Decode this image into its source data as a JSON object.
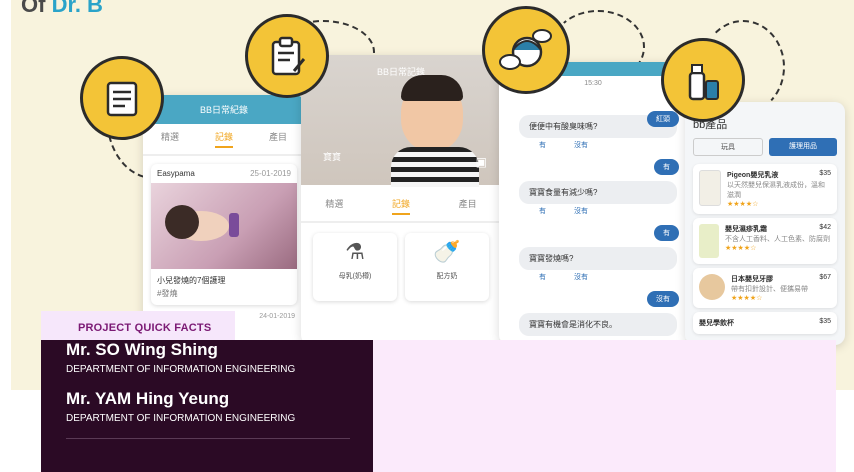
{
  "hero": {
    "title_prefix": "Of",
    "title_highlight": "Dr. B"
  },
  "phone1": {
    "header": "BB日常紀錄",
    "tabs": [
      "精選",
      "記錄",
      "產目"
    ],
    "post_author": "Easypama",
    "post_date": "25-01-2019",
    "post_caption": "小兒發燒的7個護理",
    "post_tag": "#發燒",
    "post2_date": "24-01-2019"
  },
  "phone2": {
    "header": "BB日常記錄",
    "baby_name": "寶寶",
    "tabs": [
      "精選",
      "記錄",
      "產目"
    ],
    "grid": [
      "母乳(奶樽)",
      "配方奶"
    ]
  },
  "phone3": {
    "time": "15:30",
    "top_btn": "紅頭",
    "questions": [
      "便便中有酸臭味嗎?",
      "寶寶食量有減少嗎?",
      "寶寶發燒嗎?",
      "寶寶有機會是消化不良。"
    ],
    "yes": "有",
    "no": "沒有",
    "answers": [
      "有",
      "有",
      "沒有"
    ]
  },
  "phone4": {
    "title": "bb產品",
    "tab_left": "玩具",
    "tab_right": "護理用品",
    "products": [
      {
        "name": "Pigeon嬰兒乳液",
        "price": "$35",
        "desc": "以天然嬰兒保濕乳液成份，溫和滋潤",
        "stars": "★★★★☆"
      },
      {
        "name": "嬰兒濕疹乳霜",
        "price": "$42",
        "desc": "不含人工香料、人工色素、防腐劑",
        "stars": "★★★★☆"
      },
      {
        "name": "日本嬰兒牙膠",
        "price": "$67",
        "desc": "帶有扣針設計、便攜易帶",
        "stars": "★★★★☆"
      },
      {
        "name": "嬰兒學飲杯",
        "price": "$35",
        "desc": "",
        "stars": ""
      }
    ]
  },
  "facts": {
    "label": "PROJECT QUICK FACTS",
    "people": [
      {
        "name": "Mr. SO Wing Shing",
        "dept": "DEPARTMENT OF INFORMATION ENGINEERING"
      },
      {
        "name": "Mr. YAM Hing Yeung",
        "dept": "DEPARTMENT OF INFORMATION ENGINEERING"
      }
    ]
  },
  "colors": {
    "hero_bg": "#f8f3dd",
    "accent_yellow": "#f3c437",
    "teal": "#4aa7c4",
    "facts_bg": "#2b0a25",
    "facts_label": "#7b1a74",
    "pink_panel": "#fbeafb"
  }
}
